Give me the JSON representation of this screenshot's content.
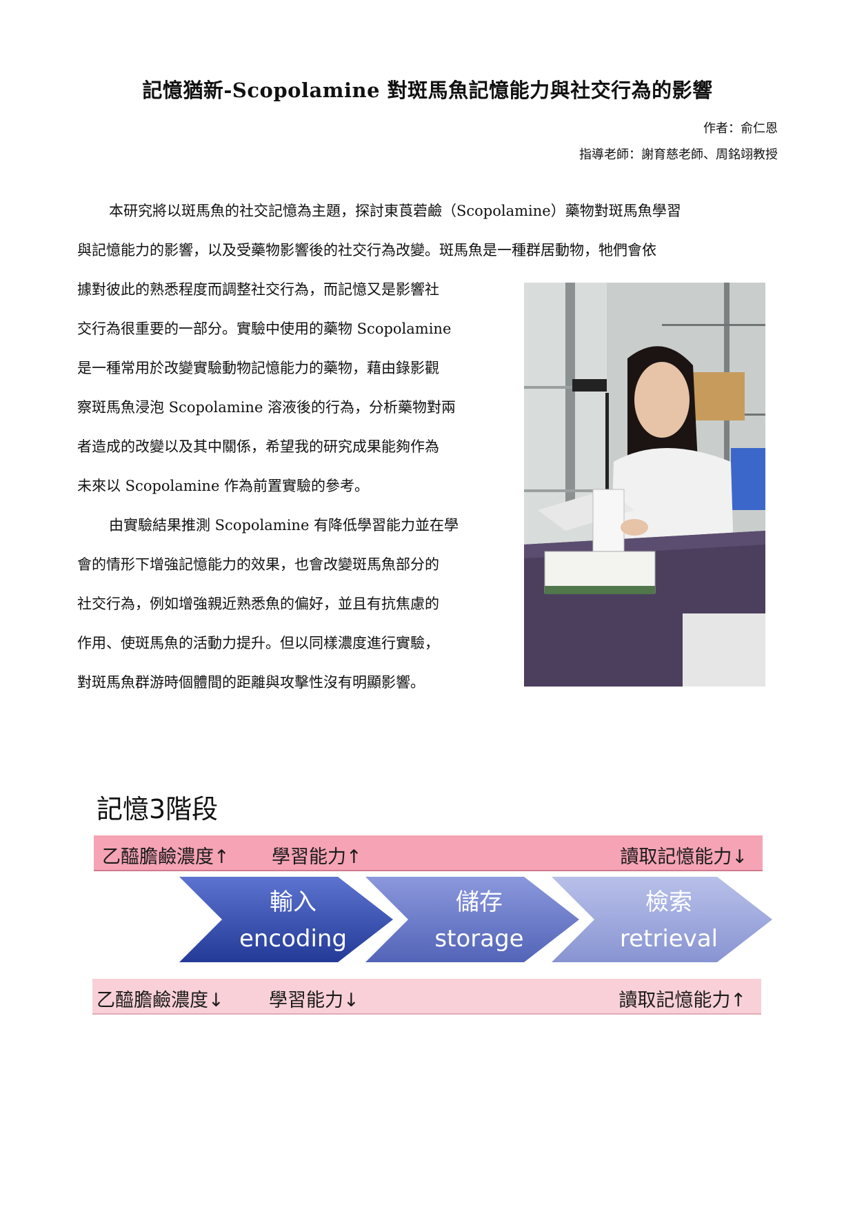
{
  "title": "記憶猶新-Scopolamine 對斑馬魚記憶能力與社交行為的影響",
  "author_line": "作者：俞仁恩",
  "advisor_line": "指導老師：謝育慈老師、周銘翊教授",
  "paragraph1": {
    "full_lines": [
      "本研究將以斑馬魚的社交記憶為主題，探討東莨菪鹼（Scopolamine）藥物對斑馬魚學習",
      "與記憶能力的影響，以及受藥物影響後的社交行為改變。斑馬魚是一種群居動物，牠們會依"
    ],
    "narrow_lines": [
      "據對彼此的熟悉程度而調整社交行為，而記憶又是影響社",
      "交行為很重要的一部分。實驗中使用的藥物 Scopolamine",
      "是一種常用於改變實驗動物記憶能力的藥物，藉由錄影觀",
      "察斑馬魚浸泡 Scopolamine 溶液後的行為，分析藥物對兩",
      "者造成的改變以及其中關係，希望我的研究成果能夠作為",
      "未來以 Scopolamine 作為前置實驗的參考。"
    ]
  },
  "paragraph2": {
    "lines": [
      "由實驗結果推測 Scopolamine 有降低學習能力並在學",
      "會的情形下增強記憶能力的效果，也會改變斑馬魚部分的",
      "社交行為，例如增強親近熟悉魚的偏好，並且有抗焦慮的",
      "作用、使斑馬魚的活動力提升。但以同樣濃度進行實驗，",
      "對斑馬魚群游時個體間的距離與攻擊性沒有明顯影響。"
    ]
  },
  "diagram": {
    "title": "記憶3階段",
    "top_band": {
      "left": "乙醯膽鹼濃度↑",
      "middle": "學習能力↑",
      "right": "讀取記憶能力↓",
      "color": "#f5a3b5"
    },
    "bottom_band": {
      "left": "乙醯膽鹼濃度↓",
      "middle": "學習能力↓",
      "right": "讀取記憶能力↑",
      "color": "#f9d0d8"
    },
    "stages": [
      {
        "zh": "輸入",
        "en": "encoding",
        "color": "#2f4aa8"
      },
      {
        "zh": "儲存",
        "en": "storage",
        "color": "#6272c4"
      },
      {
        "zh": "檢索",
        "en": "retrieval",
        "color": "#98a3d9"
      }
    ]
  }
}
